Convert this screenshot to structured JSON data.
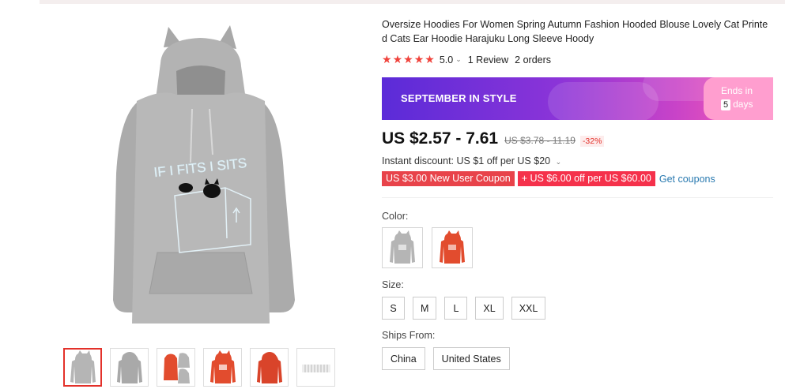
{
  "product": {
    "title": "Oversize Hoodies For Women Spring Autumn Fashion Hooded Blouse Lovely Cat Printed Cats Ear Hoodie Harajuku Long Sleeve Hoody",
    "print_text": "IF I FITS I SITS",
    "rating_value": "5.0",
    "rating_stars": 5,
    "reviews": "1 Review",
    "orders": "2 orders"
  },
  "banner": {
    "title": "SEPTEMBER IN STYLE",
    "ends_label": "Ends in",
    "ends_number": "5",
    "ends_unit": "days"
  },
  "price": {
    "current": "US $2.57 - 7.61",
    "original": "US $3.78 - 11.19",
    "discount": "-32%"
  },
  "discounts": {
    "instant": "Instant discount: US $1 off per US $20",
    "coupon_new_user": "US $3.00 New User Coupon",
    "coupon_store": "+ US $6.00 off per US $60.00",
    "get_coupons": "Get coupons"
  },
  "options": {
    "color_label": "Color:",
    "colors": [
      {
        "name": "gray",
        "hex": "#b5b5b5"
      },
      {
        "name": "orange",
        "hex": "#e24c2e"
      }
    ],
    "size_label": "Size:",
    "sizes": [
      "S",
      "M",
      "L",
      "XL",
      "XXL"
    ],
    "ships_label": "Ships From:",
    "ships_from": [
      "China",
      "United States"
    ]
  },
  "gallery": {
    "thumbnails": [
      "gray-hoodie",
      "gray-hoodie-alt",
      "orange-and-gray",
      "orange-hoodie",
      "orange-hoodie-alt",
      "size-chart"
    ],
    "active_index": 0
  },
  "colors": {
    "accent": "#f0423b",
    "coupon": "#f5314b",
    "link": "#2a7ab0",
    "hoodie_gray": "#b5b5b5",
    "hoodie_orange": "#e24c2e"
  }
}
